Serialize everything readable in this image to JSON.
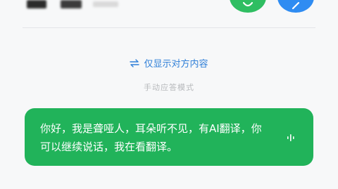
{
  "header": {
    "call_icon": "phone-icon",
    "send_icon": "send-icon",
    "colors": {
      "call": "#2fbe62",
      "send": "#2f8cf2"
    }
  },
  "toggle": {
    "icon": "swap-icon",
    "label": "仅显示对方内容"
  },
  "mode": {
    "label": "手动应答模式"
  },
  "message": {
    "text": "你好，我是聋哑人，耳朵听不见，有AI翻译，你可以继续说话，我在看翻译。",
    "icon": "voice-wave-icon",
    "bubble_color": "#21b35a"
  }
}
